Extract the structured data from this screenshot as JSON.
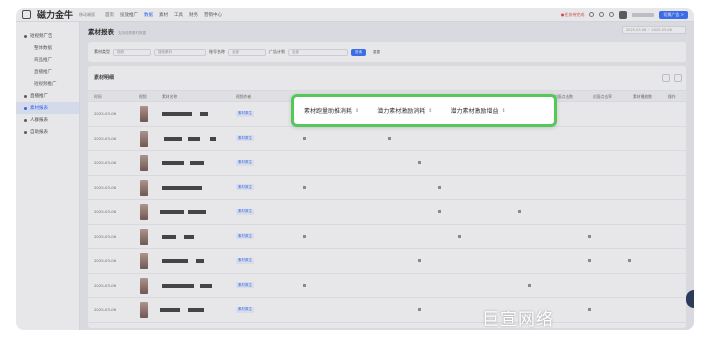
{
  "app": {
    "logo_text": "磁力金牛",
    "logo_sub": "移动端版",
    "nav": [
      "首页",
      "投放推广",
      "数据",
      "素材",
      "工具",
      "财务",
      "营销中心"
    ],
    "nav_active_index": 2,
    "alert_text": "●任务待完成",
    "switch_label": "切换广告 >"
  },
  "sidebar": {
    "items": [
      {
        "label": "短视频广告",
        "type": "parent"
      },
      {
        "label": "整体数据",
        "type": "sub"
      },
      {
        "label": "商品推广",
        "type": "sub"
      },
      {
        "label": "直播推广",
        "type": "sub"
      },
      {
        "label": "短视频推广",
        "type": "sub"
      },
      {
        "label": "直播推广",
        "type": "parent"
      },
      {
        "label": "素材报表",
        "type": "active"
      },
      {
        "label": "人群报表",
        "type": "parent"
      },
      {
        "label": "自助报表",
        "type": "parent"
      }
    ]
  },
  "page": {
    "title": "素材报表",
    "hint": "支持查看素材数据",
    "date_range": "2025-03-06 ~ 2025-03-06"
  },
  "filters": {
    "material_type_label": "素材类型",
    "material_type_value": "视频",
    "search_placeholder": "搜索素材",
    "video_id_label": "账号名称",
    "video_id_value": "全部",
    "account_label": "广告计划",
    "account_value": "全部",
    "query_button": "查询",
    "reset_button": "重置"
  },
  "table": {
    "title": "素材明细",
    "headers": [
      "时间",
      "视频",
      "素材名称",
      "视频作者",
      "",
      "",
      "",
      "",
      "",
      "",
      "花费(元)",
      "封面点击数",
      "封面点击率",
      "素材播放数",
      "操作"
    ],
    "rows": [
      {
        "date": "2025-03-06",
        "tag": "素材原生"
      },
      {
        "date": "2025-03-06",
        "tag": "素材原生"
      },
      {
        "date": "2025-03-06",
        "tag": "素材原生"
      },
      {
        "date": "2025-03-06",
        "tag": "素材原生"
      },
      {
        "date": "2025-03-06",
        "tag": "素材原生"
      },
      {
        "date": "2025-03-06",
        "tag": "素材原生"
      },
      {
        "date": "2025-03-06",
        "tag": "素材原生"
      },
      {
        "date": "2025-03-06",
        "tag": "素材原生"
      },
      {
        "date": "2025-03-06",
        "tag": "素材原生"
      }
    ]
  },
  "callout": {
    "columns": [
      "素材跑量助推消耗",
      "潜力素材激励消耗",
      "潜力素材激励增益"
    ]
  },
  "watermark": "巨宣网络",
  "colors": {
    "accent": "#2f6bff",
    "highlight_border": "#56c75a"
  }
}
